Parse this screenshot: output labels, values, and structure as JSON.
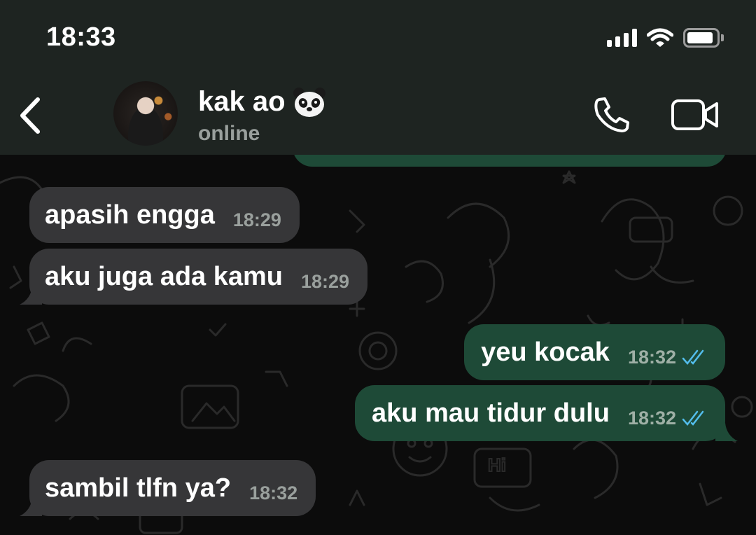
{
  "status_bar": {
    "time": "18:33"
  },
  "header": {
    "contact_name": "kak ao",
    "contact_emoji": "panda-emoji",
    "contact_status": "online"
  },
  "colors": {
    "incoming_bubble": "#363638",
    "outgoing_bubble": "#1e4a37",
    "read_ticks": "#53bdeb",
    "header_bg": "#1e2421"
  },
  "messages": [
    {
      "direction": "in",
      "text": "apasih engga",
      "time": "18:29"
    },
    {
      "direction": "in",
      "text": "aku juga ada kamu",
      "time": "18:29"
    },
    {
      "direction": "out",
      "text": "yeu kocak",
      "time": "18:32",
      "read": true
    },
    {
      "direction": "out",
      "text": "aku mau tidur dulu",
      "time": "18:32",
      "read": true
    },
    {
      "direction": "in",
      "text": "sambil tlfn ya?",
      "time": "18:32"
    }
  ],
  "pattern_text": "Hi"
}
